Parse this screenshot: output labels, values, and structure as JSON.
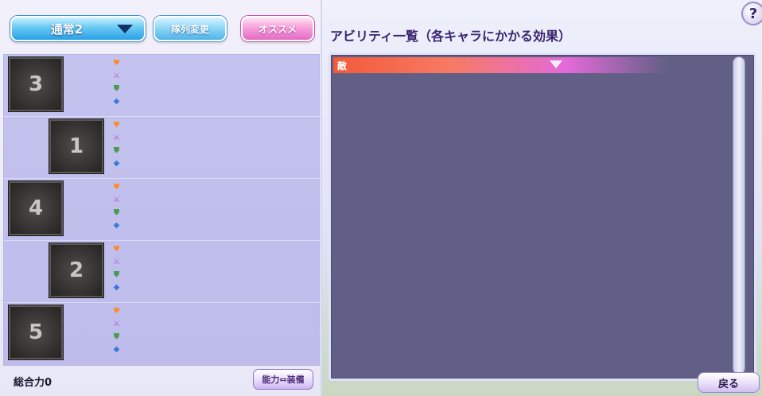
{
  "top_bar": {
    "party_select": {
      "value": "通常2",
      "icon": "chevron-down-icon"
    },
    "formation_button": "隊列変更",
    "recommend_button": "オススメ"
  },
  "party": [
    {
      "slot": "3",
      "indent": false
    },
    {
      "slot": "1",
      "indent": true
    },
    {
      "slot": "4",
      "indent": false
    },
    {
      "slot": "2",
      "indent": true
    },
    {
      "slot": "5",
      "indent": false
    }
  ],
  "stat_icons": [
    "heart-icon",
    "sword-icon",
    "shield-icon",
    "boot-icon"
  ],
  "bottom_bar": {
    "total_power_label": "総合力",
    "total_power_value": "0",
    "toggle_button": "能力⇔装備"
  },
  "ability_panel": {
    "title": "アビリティ一覧（各キャラにかかる効果）",
    "category_label": "敵",
    "help_label": "?"
  },
  "back_button": "戻る",
  "colors": {
    "list_bg": "#c4c2ee",
    "ability_bg": "#625f86",
    "category_start": "#f25a38",
    "category_end": "#b46ef0"
  }
}
